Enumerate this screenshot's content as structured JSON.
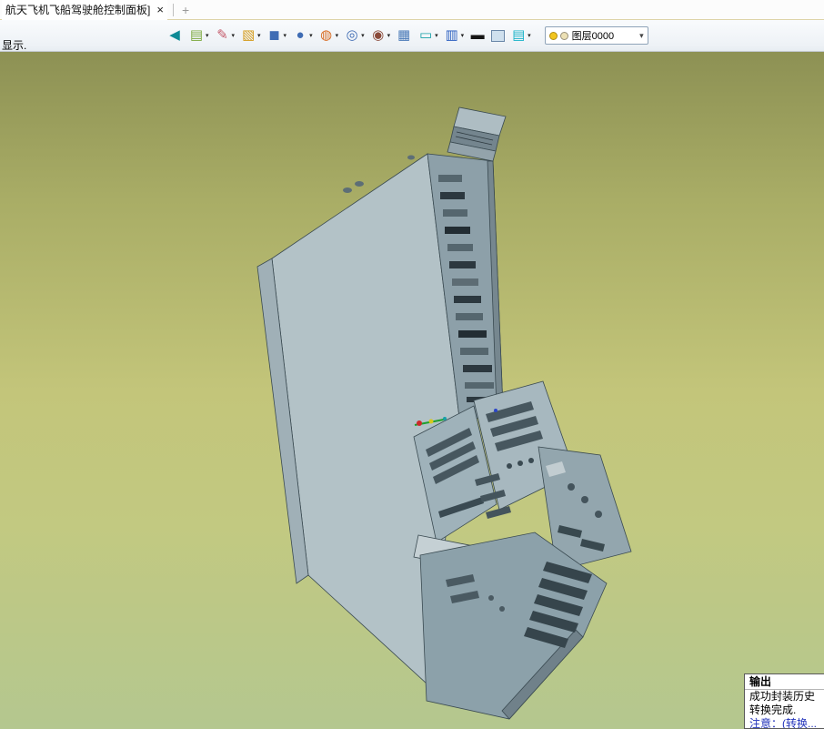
{
  "tab": {
    "title": "航天飞机飞船驾驶舱控制面板]",
    "close_glyph": "×",
    "new_tab_glyph": "+"
  },
  "toolbar": {
    "dropdown_glyph": "▾",
    "items": [
      {
        "name": "return-icon",
        "glyph": "◀",
        "color": "#0e8a96",
        "dropdown": false
      },
      {
        "name": "layers-icon",
        "glyph": "▤",
        "color": "#7aa83c",
        "dropdown": true
      },
      {
        "name": "sketch-pen-icon",
        "glyph": "✎",
        "color": "#c45a6a",
        "dropdown": true
      },
      {
        "name": "surface-box-icon",
        "glyph": "▧",
        "color": "#d49a18",
        "dropdown": true
      },
      {
        "name": "solid-cube-icon",
        "glyph": "◼",
        "color": "#3f6cb4",
        "dropdown": true
      },
      {
        "name": "sphere-icon",
        "glyph": "●",
        "color": "#3f6cb4",
        "dropdown": true
      },
      {
        "name": "wireframe-sphere-icon",
        "glyph": "◍",
        "color": "#d86a20",
        "dropdown": true
      },
      {
        "name": "circle-tool-icon",
        "glyph": "◎",
        "color": "#3f6cb4",
        "dropdown": true
      },
      {
        "name": "target-icon",
        "glyph": "◉",
        "color": "#8a4a3a",
        "dropdown": true
      },
      {
        "name": "image-view-icon",
        "glyph": "▦",
        "color": "#4a7ab8",
        "dropdown": false
      },
      {
        "name": "measure-icon",
        "glyph": "▭",
        "color": "#18a0a8",
        "dropdown": true
      },
      {
        "name": "display-mode-icon",
        "glyph": "▥",
        "color": "#2a5ec0",
        "dropdown": true
      },
      {
        "name": "black-bar-icon",
        "glyph": "▬",
        "color": "#151515",
        "dropdown": false
      },
      {
        "name": "material-swatch-icon",
        "swatch": "#cfe0ee",
        "dropdown": false
      },
      {
        "name": "cyan-layers-icon",
        "glyph": "▤",
        "color": "#18b2c8",
        "dropdown": true
      }
    ],
    "layer_combo": {
      "value": "图层0000",
      "arrow": "▾",
      "bulb_color": "#f2c51e",
      "swatch_color": "#ece0b4"
    }
  },
  "viewport": {
    "hint": "显示."
  },
  "output": {
    "title": "输出",
    "lines": [
      "成功封装历史",
      "转换完成.",
      "注意：(转换..."
    ]
  },
  "colors": {
    "viewport_top": "#8d9154",
    "viewport_mid": "#c3c57a",
    "viewport_bottom": "#b4c78f",
    "model_face": "#b3c2c7",
    "model_shade": "#8da0a9",
    "model_edge": "#3a4a51"
  }
}
